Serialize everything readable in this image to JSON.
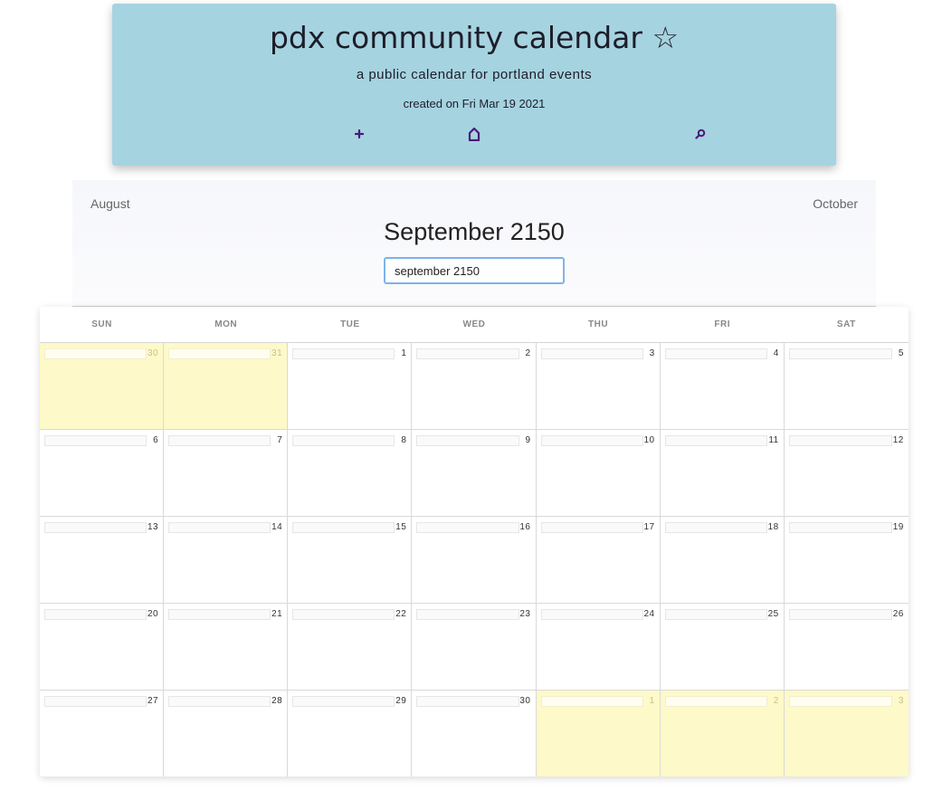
{
  "header": {
    "title": "pdx community calendar ☆",
    "subtitle": "a public calendar for portland events",
    "created": "created on Fri Mar 19 2021",
    "nav": {
      "add_icon": "plus-icon",
      "home_icon": "home-icon",
      "search_icon": "search-icon"
    }
  },
  "month_nav": {
    "prev": "August",
    "next": "October",
    "title": "September 2150",
    "input_value": "september 2150"
  },
  "calendar": {
    "weekdays": [
      "SUN",
      "MON",
      "TUE",
      "WED",
      "THU",
      "FRI",
      "SAT"
    ],
    "weeks": [
      [
        {
          "n": "30",
          "other": true
        },
        {
          "n": "31",
          "other": true
        },
        {
          "n": "1"
        },
        {
          "n": "2"
        },
        {
          "n": "3"
        },
        {
          "n": "4"
        },
        {
          "n": "5"
        }
      ],
      [
        {
          "n": "6"
        },
        {
          "n": "7"
        },
        {
          "n": "8"
        },
        {
          "n": "9"
        },
        {
          "n": "10"
        },
        {
          "n": "11"
        },
        {
          "n": "12"
        }
      ],
      [
        {
          "n": "13"
        },
        {
          "n": "14"
        },
        {
          "n": "15"
        },
        {
          "n": "16"
        },
        {
          "n": "17"
        },
        {
          "n": "18"
        },
        {
          "n": "19"
        }
      ],
      [
        {
          "n": "20"
        },
        {
          "n": "21"
        },
        {
          "n": "22"
        },
        {
          "n": "23"
        },
        {
          "n": "24"
        },
        {
          "n": "25"
        },
        {
          "n": "26"
        }
      ],
      [
        {
          "n": "27"
        },
        {
          "n": "28"
        },
        {
          "n": "29"
        },
        {
          "n": "30"
        },
        {
          "n": "1",
          "other": true
        },
        {
          "n": "2",
          "other": true
        },
        {
          "n": "3",
          "other": true
        }
      ]
    ]
  },
  "colors": {
    "header_bg": "#a6d3e0",
    "icon_purple": "#4a1a7a",
    "other_month_bg": "#fef9c8"
  }
}
